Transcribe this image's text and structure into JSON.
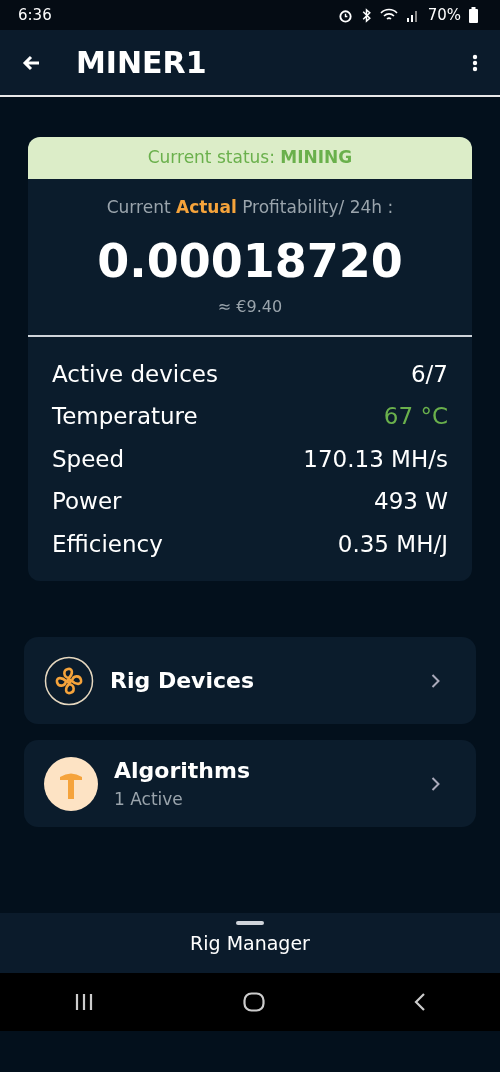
{
  "status_bar": {
    "time": "6:36",
    "battery": "70%"
  },
  "app_bar": {
    "title": "MINER1"
  },
  "summary": {
    "status_label": "Current status:",
    "status_value": "MINING",
    "profit_label": "Current **Actual** Profitability/ 24h :",
    "profit_value": "0.00018720",
    "fiat_value": "≈ €9.40",
    "stats": [
      {
        "label": "Active devices",
        "value": "6/7",
        "color": "#ffffff"
      },
      {
        "label": "Temperature",
        "value": "67 °C",
        "color": "#6ab04c"
      },
      {
        "label": "Speed",
        "value": "170.13 MH/s",
        "color": "#ffffff"
      },
      {
        "label": "Power",
        "value": "493 W",
        "color": "#ffffff"
      },
      {
        "label": "Efficiency",
        "value": "0.35 MH/J",
        "color": "#ffffff"
      }
    ]
  },
  "menu": [
    {
      "kind": "fan",
      "title": "Rig Devices"
    },
    {
      "kind": "pickaxe",
      "title": "Algorithms",
      "subtitle": "1 Active"
    }
  ],
  "bottom_sheet": {
    "title": "Rig Manager"
  }
}
